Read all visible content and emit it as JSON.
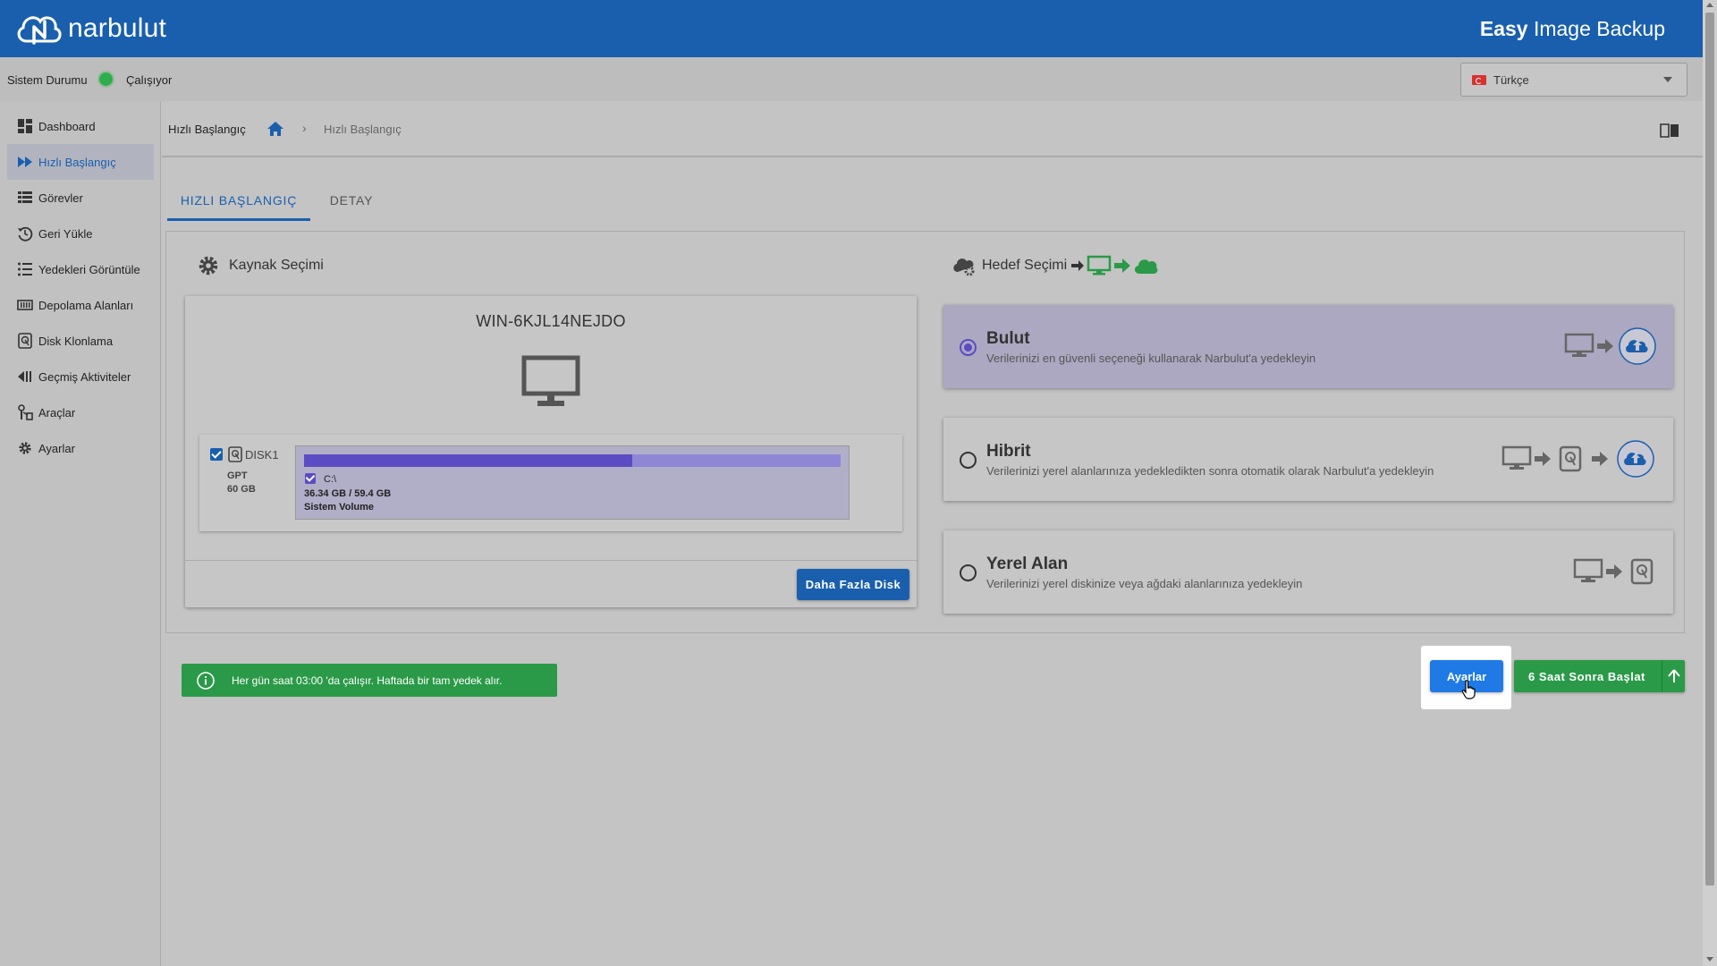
{
  "header": {
    "logo_text": "narbulut",
    "app_title_bold": "Easy",
    "app_title_rest": " Image Backup"
  },
  "status": {
    "label": "Sistem Durumu",
    "value": "Çalışıyor",
    "indicator_color": "#2eae4b"
  },
  "language": {
    "selected": "Türkçe",
    "flag_icon": "turkey-flag-icon"
  },
  "sidebar": {
    "items": [
      {
        "label": "Dashboard",
        "icon": "dashboard-icon"
      },
      {
        "label": "Hızlı Başlangıç",
        "icon": "fast-forward-icon"
      },
      {
        "label": "Görevler",
        "icon": "task-list-icon"
      },
      {
        "label": "Geri Yükle",
        "icon": "history-icon"
      },
      {
        "label": "Yedekleri Görüntüle",
        "icon": "list-icon"
      },
      {
        "label": "Depolama Alanları",
        "icon": "storage-icon"
      },
      {
        "label": "Disk Klonlama",
        "icon": "disk-clone-icon"
      },
      {
        "label": "Geçmiş Aktiviteler",
        "icon": "activity-icon"
      },
      {
        "label": "Araçlar",
        "icon": "tools-icon"
      },
      {
        "label": "Ayarlar",
        "icon": "gear-icon"
      }
    ],
    "active_index": 1
  },
  "breadcrumb": {
    "title": "Hızlı Başlangıç",
    "separator": "›",
    "current": "Hızlı Başlangıç"
  },
  "tabs": [
    {
      "label": "HIZLI BAŞLANGIÇ",
      "active": true
    },
    {
      "label": "DETAY",
      "active": false
    }
  ],
  "source": {
    "title": "Kaynak Seçimi",
    "host": "WIN-6KJL14NEJDO",
    "disk": {
      "name": "DISK1",
      "type": "GPT",
      "size": "60 GB",
      "checked": true,
      "partition": {
        "letter": "C:\\",
        "usage": "36.34 GB / 59.4 GB",
        "label": "Sistem Volume",
        "used_fraction": 0.612,
        "checked": true
      }
    },
    "more_button": "Daha Fazla Disk"
  },
  "destination": {
    "title": "Hedef Seçimi",
    "options": [
      {
        "title": "Bulut",
        "desc": "Verilerinizi en güvenli seçeneği kullanarak Narbulut'a yedekleyin",
        "selected": true
      },
      {
        "title": "Hibrit",
        "desc": "Verilerinizi yerel alanlarınıza yedekledikten sonra otomatik olarak Narbulut'a yedekleyin",
        "selected": false
      },
      {
        "title": "Yerel Alan",
        "desc": "Verilerinizi yerel diskinize veya ağdaki alanlarınıza yedekleyin",
        "selected": false
      }
    ]
  },
  "schedule_info": "Her gün saat 03:00 'da çalışır. Haftada bir tam yedek alır.",
  "buttons": {
    "settings": "Ayarlar",
    "start": "6 Saat Sonra Başlat"
  },
  "colors": {
    "header": "#1a5fae",
    "accent": "#1a5fae",
    "success": "#2a9a48",
    "partition": "#5b4cc3"
  }
}
